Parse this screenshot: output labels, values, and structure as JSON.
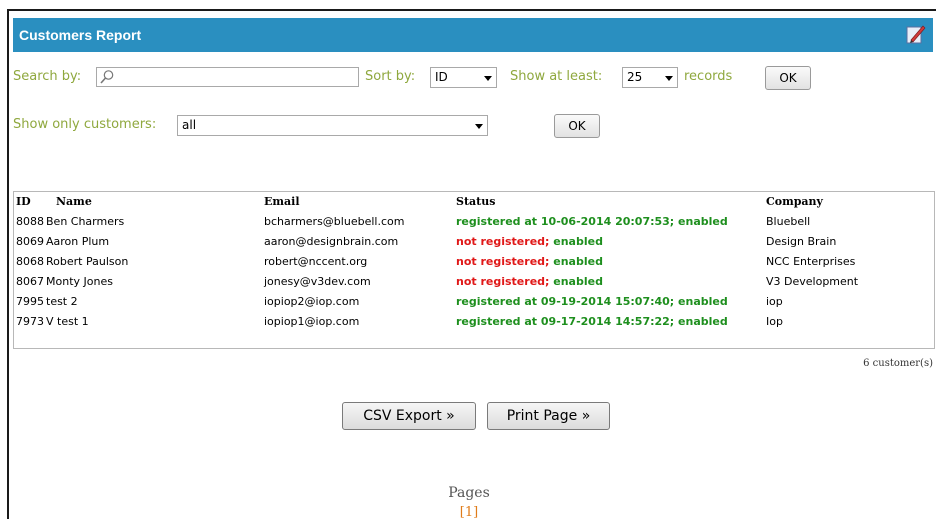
{
  "header": {
    "title": "Customers Report"
  },
  "filters": {
    "search_label": "Search by:",
    "search_value": "",
    "sort_label": "Sort by:",
    "sort_value": "ID",
    "show_at_least_label": "Show at least:",
    "show_at_least_value": "25",
    "records_label": "records",
    "ok_label": "OK",
    "show_only_label": "Show only customers:",
    "show_only_value": "all",
    "ok2_label": "OK"
  },
  "table": {
    "columns": [
      "ID",
      "Name",
      "Email",
      "Status",
      "Company"
    ],
    "rows": [
      {
        "id": "8088",
        "name": "Ben Charmers",
        "email": "bcharmers@bluebell.com",
        "status_a": "registered at 10-06-2014 20:07:53; enabled",
        "status_b": "",
        "company": "Bluebell"
      },
      {
        "id": "8069",
        "name": "Aaron Plum",
        "email": "aaron@designbrain.com",
        "status_a": "not registered;",
        "status_b": " enabled",
        "company": "Design Brain"
      },
      {
        "id": "8068",
        "name": "Robert Paulson",
        "email": "robert@nccent.org",
        "status_a": "not registered;",
        "status_b": " enabled",
        "company": "NCC Enterprises"
      },
      {
        "id": "8067",
        "name": "Monty Jones",
        "email": "jonesy@v3dev.com",
        "status_a": "not registered;",
        "status_b": " enabled",
        "company": "V3 Development"
      },
      {
        "id": "7995",
        "name": "test 2",
        "email": "iopiop2@iop.com",
        "status_a": "registered at 09-19-2014 15:07:40; enabled",
        "status_b": "",
        "company": "iop"
      },
      {
        "id": "7973",
        "name": "V test 1",
        "email": "iopiop1@iop.com",
        "status_a": "registered at 09-17-2014 14:57:22; enabled",
        "status_b": "",
        "company": "Iop"
      }
    ],
    "count_text": "6 customer(s)"
  },
  "actions": {
    "csv_label": "CSV Export »",
    "print_label": "Print Page »"
  },
  "pagination": {
    "label": "Pages",
    "current": "[1]"
  },
  "colors": {
    "header_bg": "#2a8fc0",
    "label_green": "#8fa83e",
    "status_green": "#1e8f1e",
    "status_red": "#e01818",
    "page_orange": "#e07c1a"
  },
  "icons": {
    "header": "edit-report-icon",
    "search": "magnifier-icon"
  }
}
